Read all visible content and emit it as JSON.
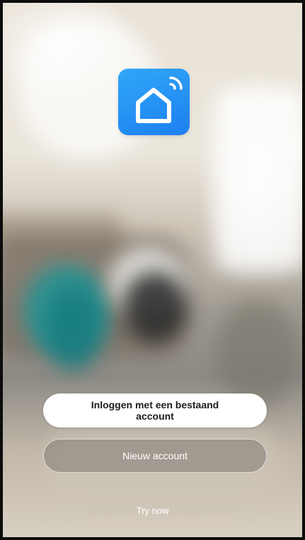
{
  "app": {
    "logo_icon": "smart-home-house-wifi-icon",
    "accent_color": "#2491f4"
  },
  "buttons": {
    "login_existing": "Inloggen met een bestaand account",
    "new_account": "Nieuw account",
    "try_now": "Try now"
  }
}
